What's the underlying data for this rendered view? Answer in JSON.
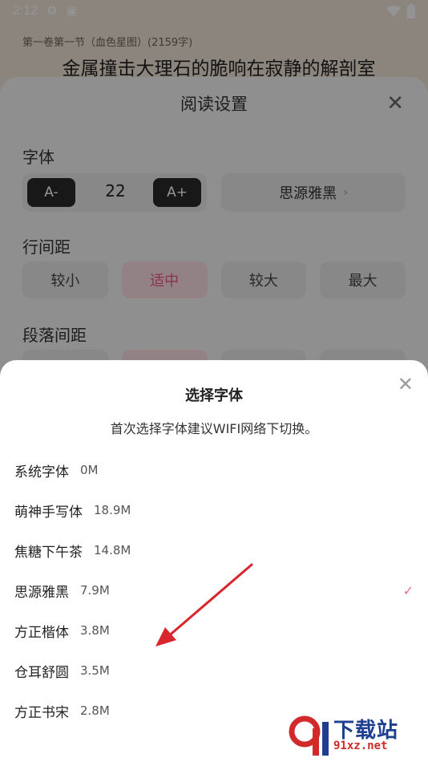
{
  "status_bar": {
    "time": "2:12",
    "icons": [
      "app-icon",
      "a-badge-icon"
    ],
    "right_icons": [
      "wifi-icon",
      "battery-icon"
    ]
  },
  "reading": {
    "chapter_label": "第一卷第一节（血色星图）(2159字)",
    "title": "金属撞击大理石的脆响在寂静的解剖室"
  },
  "settings": {
    "title": "阅读设置",
    "font_label": "字体",
    "size_minus": "A-",
    "size_value": "22",
    "size_plus": "A+",
    "font_family_current": "思源雅黑",
    "line_spacing_label": "行间距",
    "line_spacing_options": [
      "较小",
      "适中",
      "较大",
      "最大"
    ],
    "line_spacing_selected": 1,
    "paragraph_spacing_label": "段落间距"
  },
  "font_sheet": {
    "title": "选择字体",
    "hint": "首次选择字体建议WIFI网络下切换。",
    "items": [
      {
        "name": "系统字体",
        "size": "0M"
      },
      {
        "name": "萌神手写体",
        "size": "18.9M"
      },
      {
        "name": "焦糖下午茶",
        "size": "14.8M"
      },
      {
        "name": "思源雅黑",
        "size": "7.9M",
        "selected": true
      },
      {
        "name": "方正楷体",
        "size": "3.8M"
      },
      {
        "name": "仓耳舒圆",
        "size": "3.5M"
      },
      {
        "name": "方正书宋",
        "size": "2.8M"
      }
    ]
  },
  "watermark": {
    "text": "下载站",
    "url": "91xz.net"
  },
  "colors": {
    "accent": "#ee5c80",
    "annotation_arrow": "#d9262c"
  }
}
